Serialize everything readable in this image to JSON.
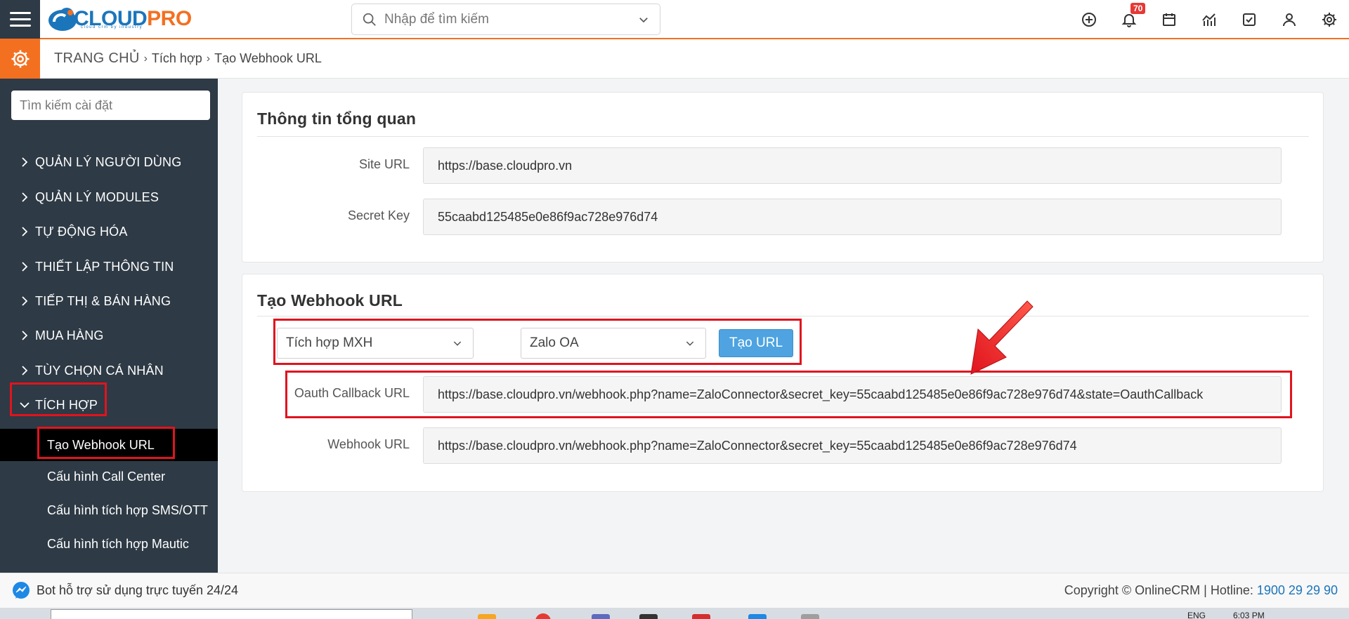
{
  "header": {
    "logo_main": "CLOUD",
    "logo_accent": "PRO",
    "logo_tagline": "cloud crm by industry",
    "search_placeholder": "Nhập để tìm kiếm",
    "notification_count": "70",
    "icons": [
      "plus-circle-icon",
      "bell-icon",
      "calendar-icon",
      "chart-icon",
      "checkbox-icon",
      "user-icon",
      "gear-icon"
    ]
  },
  "breadcrumb": {
    "home": "TRANG CHỦ",
    "level1": "Tích hợp",
    "level2": "Tạo Webhook URL"
  },
  "sidebar": {
    "search_placeholder": "Tìm kiếm cài đặt",
    "items": [
      {
        "label": "QUẢN LÝ NGƯỜI DÙNG"
      },
      {
        "label": "QUẢN LÝ MODULES"
      },
      {
        "label": "TỰ ĐỘNG HÓA"
      },
      {
        "label": "THIẾT LẬP THÔNG TIN"
      },
      {
        "label": "TIẾP THỊ & BÁN HÀNG"
      },
      {
        "label": "MUA HÀNG"
      },
      {
        "label": "TÙY CHỌN CÁ NHÂN"
      },
      {
        "label": "TÍCH HỢP"
      }
    ],
    "sub_items": [
      {
        "label": "Tạo Webhook URL"
      },
      {
        "label": "Cấu hình Call Center"
      },
      {
        "label": "Cấu hình tích hợp SMS/OTT"
      },
      {
        "label": "Cấu hình tích hợp Mautic"
      }
    ]
  },
  "overview": {
    "title": "Thông tin tổng quan",
    "site_url_label": "Site URL",
    "site_url_value": "https://base.cloudpro.vn",
    "secret_key_label": "Secret Key",
    "secret_key_value": "55caabd125485e0e86f9ac728e976d74"
  },
  "webhook": {
    "title": "Tạo Webhook URL",
    "integration_select": "Tích hợp MXH",
    "connector_select": "Zalo OA",
    "create_button": "Tạo URL",
    "oauth_label": "Oauth Callback URL",
    "oauth_value": "https://base.cloudpro.vn/webhook.php?name=ZaloConnector&secret_key=55caabd125485e0e86f9ac728e976d74&state=OauthCallback",
    "webhook_label": "Webhook URL",
    "webhook_value": "https://base.cloudpro.vn/webhook.php?name=ZaloConnector&secret_key=55caabd125485e0e86f9ac728e976d74"
  },
  "footer": {
    "bot_text": "Bot hỗ trợ sử dụng trực tuyến 24/24",
    "copyright": "Copyright © OnlineCRM",
    "hotline_label": "Hotline:",
    "hotline_number": "1900 29 29 90"
  },
  "taskbar": {
    "lang": "ENG",
    "time": "6:03 PM"
  },
  "colors": {
    "accent_orange": "#f37021",
    "brand_blue": "#1b75bb",
    "sidebar_bg": "#2e3a45",
    "highlight_red": "#e0141e",
    "button_blue": "#4ea3e0"
  }
}
